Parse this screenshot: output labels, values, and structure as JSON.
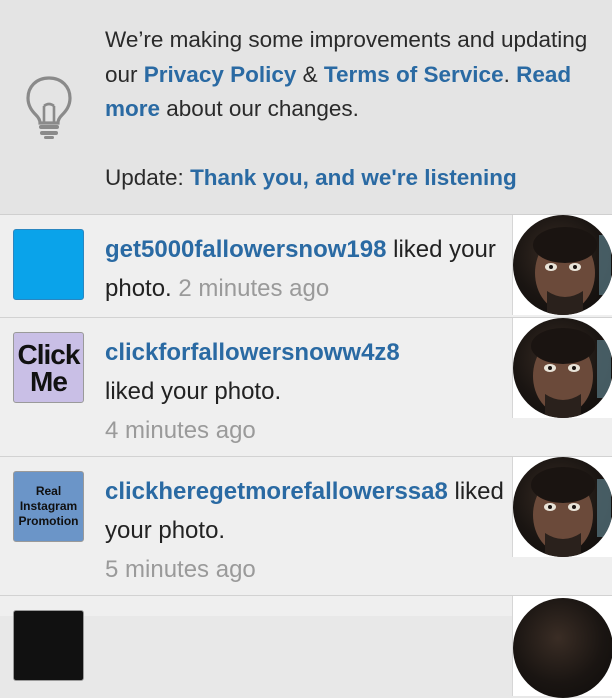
{
  "banner": {
    "line_text_1": "We’re making some improvements and updating our ",
    "privacy_link": "Privacy Policy",
    "amp": " & ",
    "terms_link": "Terms of Service",
    "period": ". ",
    "read_more_link": "Read more",
    "line_text_2": " about our changes.",
    "update_label": "Update: ",
    "update_link": "Thank you, and we're listening",
    "icon": "lightbulb-icon"
  },
  "notifications": [
    {
      "avatar_style": "blue",
      "username": "get5000fallowersnow198",
      "action": " liked your photo.",
      "time": "2 minutes ago"
    },
    {
      "avatar_style": "click-me",
      "avatar_text": "Click Me",
      "username": "clickforfallowersnoww4z8",
      "action": "liked your photo.",
      "time": "4 minutes ago"
    },
    {
      "avatar_style": "real-instagram",
      "avatar_text": "Real Instagram Promotion",
      "username": "clickheregetmorefallowerssa8",
      "action": " liked your photo.",
      "time": "5 minutes ago"
    }
  ],
  "colors": {
    "link": "#2a6aa3",
    "time": "#9a9a9a",
    "background": "#e8e8e8"
  }
}
